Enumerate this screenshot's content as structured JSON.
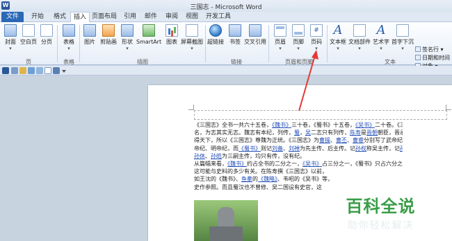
{
  "window": {
    "title": "三国志 - Microsoft Word",
    "app_icon": "W"
  },
  "tabs": [
    {
      "label": "文件",
      "kind": "file"
    },
    {
      "label": "开始"
    },
    {
      "label": "格式"
    },
    {
      "label": "插入",
      "active": true
    },
    {
      "label": "页面布局"
    },
    {
      "label": "引用"
    },
    {
      "label": "邮件"
    },
    {
      "label": "审阅"
    },
    {
      "label": "视图"
    },
    {
      "label": "开发工具"
    }
  ],
  "ribbon": {
    "buttons": [
      {
        "label": "封面",
        "sub": "▾"
      },
      {
        "label": "空白页"
      },
      {
        "label": "分页"
      },
      {
        "label": "表格",
        "sub": "▾"
      },
      {
        "label": "图片"
      },
      {
        "label": "剪贴画"
      },
      {
        "label": "形状",
        "sub": "▾"
      },
      {
        "label": "SmartArt"
      },
      {
        "label": "图表"
      },
      {
        "label": "屏幕截图",
        "sub": "▾"
      },
      {
        "label": "超链接"
      },
      {
        "label": "书签"
      },
      {
        "label": "交叉引用"
      },
      {
        "label": "页眉",
        "sub": "▾"
      },
      {
        "label": "页脚",
        "sub": "▾"
      },
      {
        "label": "页码",
        "sub": "▾"
      },
      {
        "label": "文本框",
        "sub": "▾"
      },
      {
        "label": "文档部件",
        "sub": "▾"
      },
      {
        "label": "艺术字",
        "sub": "▾"
      },
      {
        "label": "首字下沉",
        "sub": "▾"
      }
    ],
    "small_items": [
      "签名行 ▾",
      "日期和时间",
      "对象 ▾"
    ],
    "groups": [
      "页",
      "表格",
      "插图",
      "链接",
      "页眉和页脚",
      "文本"
    ]
  },
  "document": {
    "lines": [
      [
        "《三国志》全书一共六十五卷，",
        {
          "link": "《魏书》"
        },
        "三十卷，《蜀书》十五卷，",
        {
          "link": "《吴书》"
        },
        "二十卷。《三国志》"
      ],
      [
        "名，为志其实无志。魏志有本纪，列传，",
        {
          "link": "蜀"
        },
        "，",
        {
          "link": "吴"
        },
        "二志只有列传，",
        {
          "link": "陈寿"
        },
        "是",
        {
          "link": "晋朝"
        },
        "朝臣，晋承魏而"
      ],
      [
        "得天下，所以《三国志》尊魏为正统。《三国志》为",
        {
          "link": "曹操"
        },
        "、",
        {
          "link": "曹丕"
        },
        "、",
        {
          "link": "曹睿"
        },
        "分别写了武帝纪、文"
      ],
      [
        "帝纪、明帝纪，而",
        {
          "link": "《蜀书》"
        },
        "则记",
        {
          "link": "刘备"
        },
        "、",
        {
          "link": "刘禅"
        },
        "为先主传、后主传。记",
        {
          "link": "孙权"
        },
        "称吴主传，记",
        {
          "link": "孙亮"
        },
        "、"
      ],
      [
        {
          "link": "孙休"
        },
        "、",
        {
          "link": "孙皓"
        },
        "为三嗣主传，均只有传，没有纪。"
      ],
      [
        "从篇幅来看，",
        {
          "link": "《魏书》"
        },
        "约占全书的二分之一，",
        {
          "link": "《吴书》"
        },
        "占三分之一，《蜀书》只占六分之一，"
      ],
      [
        "这可能与史料的多少有关。在陈寿撰《三国志》以前，"
      ],
      [
        "如王沈的《魏书》、",
        {
          "link": "鱼豢"
        },
        "的",
        {
          "link": "《魏略》"
        },
        "、韦昭的《吴书》等，"
      ],
      [
        "史作参照。而且蜀汉也不曾修、吴二国设有史官，这"
      ]
    ]
  },
  "watermark": {
    "main": "百科全说",
    "sub": "助你轻松解决"
  }
}
